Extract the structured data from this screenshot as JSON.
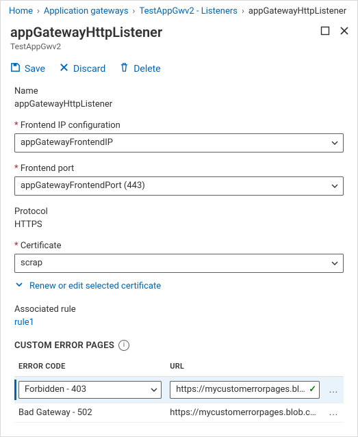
{
  "breadcrumbs": {
    "home": "Home",
    "level1": "Application gateways",
    "level2": "TestAppGwv2 - Listeners",
    "current": "appGatewayHttpListener"
  },
  "header": {
    "title": "appGatewayHttpListener",
    "subtitle": "TestAppGwv2"
  },
  "toolbar": {
    "save": "Save",
    "discard": "Discard",
    "delete": "Delete"
  },
  "fields": {
    "name": {
      "label": "Name",
      "value": "appGatewayHttpListener"
    },
    "frontend_ip": {
      "label": "Frontend IP configuration",
      "value": "appGatewayFrontendIP"
    },
    "frontend_port": {
      "label": "Frontend port",
      "value": "appGatewayFrontendPort (443)"
    },
    "protocol": {
      "label": "Protocol",
      "value": "HTTPS"
    },
    "certificate": {
      "label": "Certificate",
      "value": "scrap"
    },
    "renew_link": "Renew or edit selected certificate",
    "associated_rule": {
      "label": "Associated rule",
      "value": "rule1"
    }
  },
  "custom_error": {
    "title": "CUSTOM ERROR PAGES",
    "columns": {
      "code": "ERROR CODE",
      "url": "URL"
    },
    "rows": [
      {
        "code": "Forbidden - 403",
        "url": "https://mycustomerrorpages.blob.core.w",
        "editing": true,
        "valid": true
      },
      {
        "code": "Bad Gateway - 502",
        "url": "https://mycustomerrorpages.blob.core.wind…",
        "editing": false
      }
    ],
    "actions_label": "..."
  }
}
